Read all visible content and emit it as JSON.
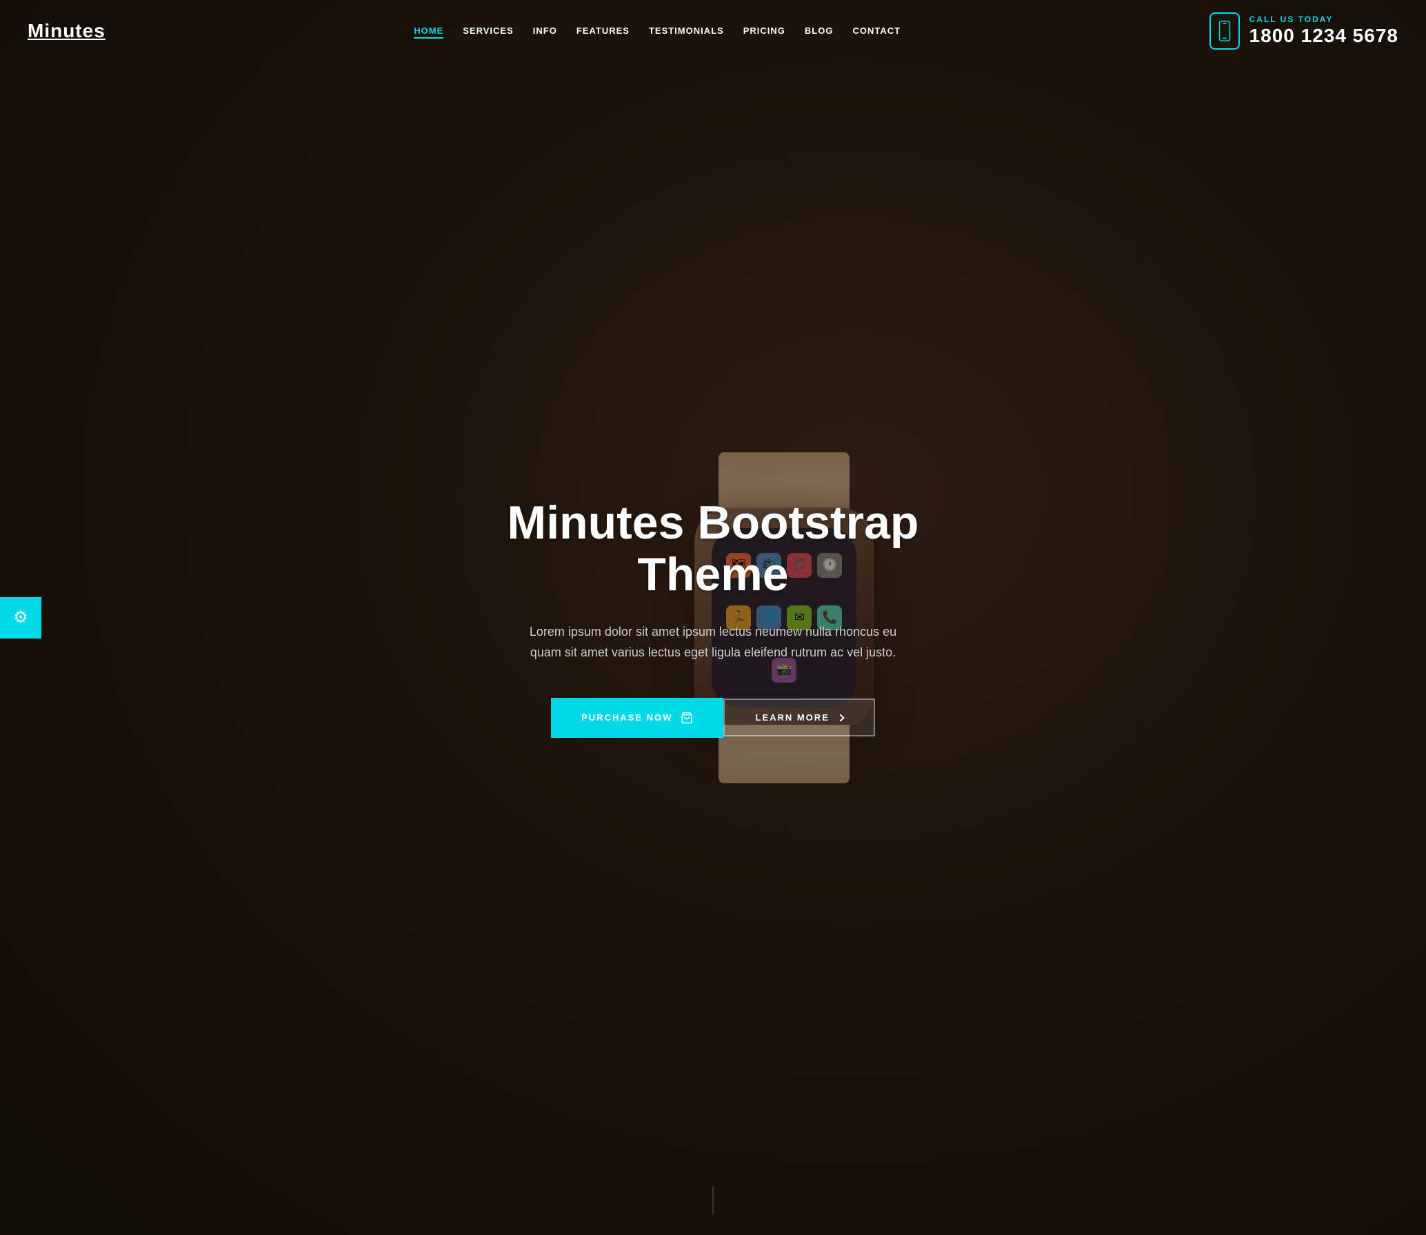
{
  "header": {
    "logo": "Minutes",
    "nav": [
      {
        "label": "HOME",
        "active": true,
        "id": "home"
      },
      {
        "label": "SERVICES",
        "active": false,
        "id": "services"
      },
      {
        "label": "INFO",
        "active": false,
        "id": "info"
      },
      {
        "label": "FEATURES",
        "active": false,
        "id": "features"
      },
      {
        "label": "TESTIMONIALS",
        "active": false,
        "id": "testimonials"
      },
      {
        "label": "PRICING",
        "active": false,
        "id": "pricing"
      },
      {
        "label": "BLOG",
        "active": false,
        "id": "blog"
      },
      {
        "label": "CONTACT",
        "active": false,
        "id": "contact"
      }
    ],
    "callUs": {
      "label": "CALL US TODAY",
      "phone": "1800 1234 5678"
    }
  },
  "hero": {
    "title": "Minutes Bootstrap Theme",
    "subtitle": "Lorem ipsum dolor sit amet ipsum lectus neumew nulla rhoncus eu quam sit amet varius lectus eget ligula eleifend rutrum ac vel justo.",
    "purchaseButton": "PURCHASE NOW",
    "learnMoreButton": "LEARN MORE"
  },
  "settings": {
    "icon": "⚙"
  },
  "colors": {
    "accent": "#00d9e8",
    "dark": "#1a1008"
  }
}
